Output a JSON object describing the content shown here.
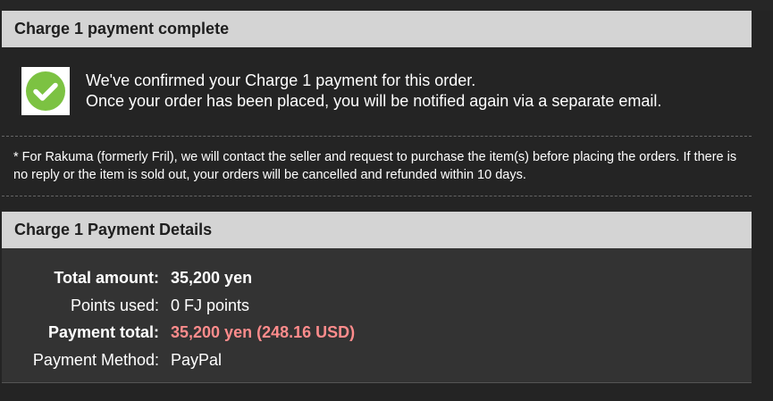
{
  "colors": {
    "background": "#242424",
    "header_bg": "#d4d4d4",
    "details_bg": "#333333",
    "check_green": "#7cc242",
    "highlight": "#ff8c8c"
  },
  "confirmation": {
    "title": "Charge 1 payment complete",
    "icon": "check-circle-icon",
    "line1": "We've confirmed your Charge 1 payment for this order.",
    "line2": "Once your order has been placed, you will be notified again via a separate email."
  },
  "notice": {
    "text": "* For Rakuma (formerly Fril), we will contact the seller and request to purchase the item(s) before placing the orders. If there is no reply or the item is sold out, your orders will be cancelled and refunded within 10 days."
  },
  "details": {
    "title": "Charge 1 Payment Details",
    "total_amount_label": "Total amount:",
    "total_amount_value": "35,200 yen",
    "points_used_label": "Points used:",
    "points_used_value": "0 FJ points",
    "payment_total_label": "Payment total:",
    "payment_total_value": "35,200 yen (248.16 USD)",
    "payment_method_label": "Payment Method:",
    "payment_method_value": "PayPal"
  }
}
